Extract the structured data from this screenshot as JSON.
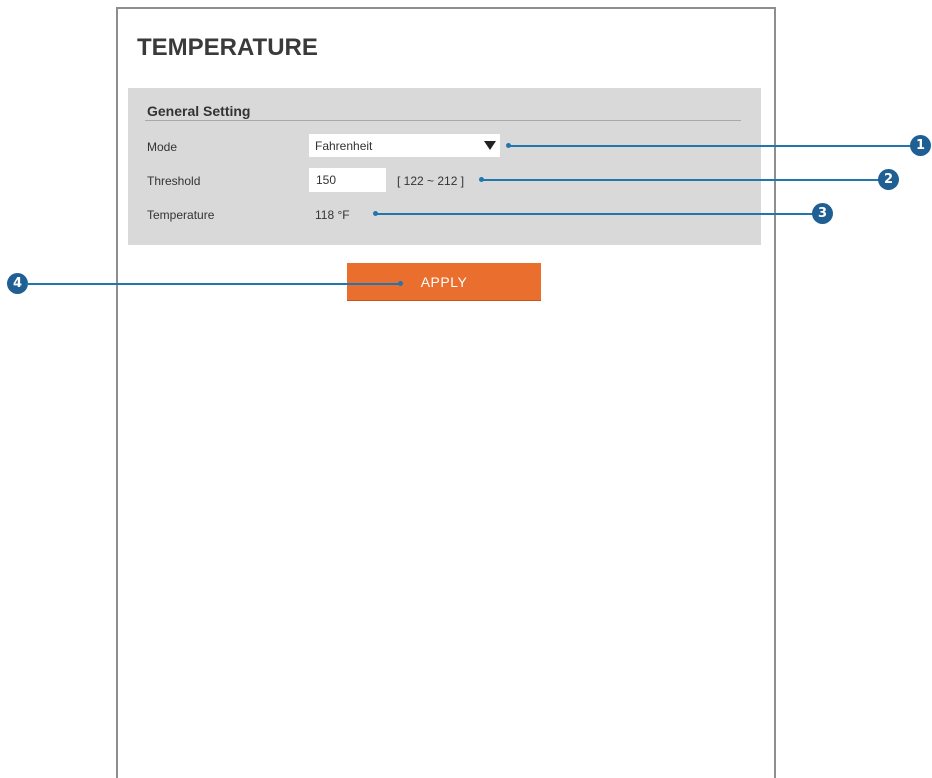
{
  "page": {
    "title": "TEMPERATURE"
  },
  "general_setting": {
    "title": "General Setting",
    "mode": {
      "label": "Mode",
      "value": "Fahrenheit",
      "icon": "dropdown-arrow-icon"
    },
    "threshold": {
      "label": "Threshold",
      "value": "150",
      "range": "[ 122 ~ 212 ]"
    },
    "temperature": {
      "label": "Temperature",
      "value": "118 °F"
    }
  },
  "actions": {
    "apply_label": "APPLY"
  },
  "callouts": [
    "1",
    "2",
    "3",
    "4"
  ],
  "colors": {
    "panel": "#d9d9d9",
    "apply": "#ea6f2f",
    "callout": "#2376ad",
    "badge": "#1f5f93"
  }
}
